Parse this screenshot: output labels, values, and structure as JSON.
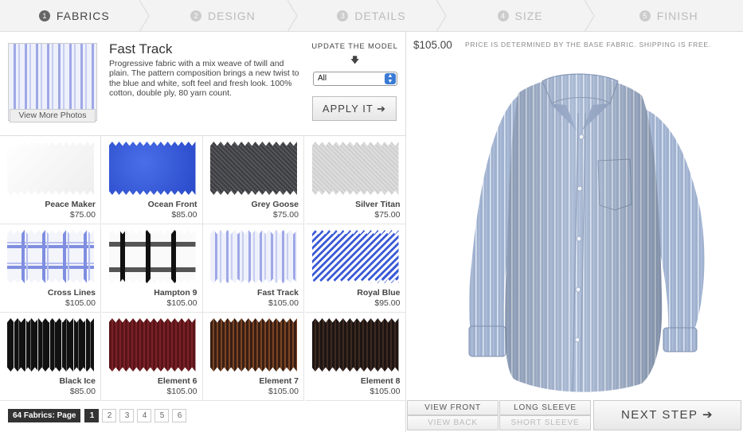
{
  "steps": [
    {
      "num": "1",
      "label": "FABRICS",
      "active": true
    },
    {
      "num": "2",
      "label": "DESIGN",
      "active": false
    },
    {
      "num": "3",
      "label": "DETAILS",
      "active": false
    },
    {
      "num": "4",
      "label": "SIZE",
      "active": false
    },
    {
      "num": "5",
      "label": "FINISH",
      "active": false
    }
  ],
  "selected_fabric": {
    "name": "Fast Track",
    "description": "Progressive fabric with a mix weave of twill and plain. The pattern composition brings a new twist to the blue and white, soft feel and fresh look. 100% cotton, double ply, 80 yarn count.",
    "view_more_label": "View More Photos"
  },
  "update_model": {
    "label": "UPDATE THE MODEL",
    "arrow_icon": "down-arrow",
    "select_value": "All",
    "apply_label": "APPLY IT ➔"
  },
  "fabrics": [
    {
      "name": "Peace Maker",
      "price": "$75.00",
      "pattern": "white"
    },
    {
      "name": "Ocean Front",
      "price": "$85.00",
      "pattern": "blue"
    },
    {
      "name": "Grey Goose",
      "price": "$75.00",
      "pattern": "darkgrey"
    },
    {
      "name": "Silver Titan",
      "price": "$75.00",
      "pattern": "lightgrey"
    },
    {
      "name": "Cross Lines",
      "price": "$105.00",
      "pattern": "check-blue"
    },
    {
      "name": "Hampton 9",
      "price": "$105.00",
      "pattern": "check-black"
    },
    {
      "name": "Fast Track",
      "price": "$105.00",
      "pattern": "stripe-blue"
    },
    {
      "name": "Royal Blue",
      "price": "$95.00",
      "pattern": "diag-blue"
    },
    {
      "name": "Black Ice",
      "price": "$85.00",
      "pattern": "black-stripe"
    },
    {
      "name": "Element 6",
      "price": "$105.00",
      "pattern": "maroon"
    },
    {
      "name": "Element 7",
      "price": "$105.00",
      "pattern": "brown"
    },
    {
      "name": "Element 8",
      "price": "$105.00",
      "pattern": "darkbrown"
    }
  ],
  "pager": {
    "label": "64 Fabrics: Page",
    "pages": [
      "1",
      "2",
      "3",
      "4",
      "5",
      "6"
    ],
    "current": "1"
  },
  "pricing": {
    "price": "$105.00",
    "note": "PRICE IS DETERMINED BY THE BASE FABRIC. SHIPPING IS FREE."
  },
  "view_controls": {
    "view_front": "VIEW FRONT",
    "view_back": "VIEW BACK",
    "long_sleeve": "LONG SLEEVE",
    "short_sleeve": "SHORT SLEEVE",
    "next_step": "NEXT STEP ➔"
  },
  "colors": {
    "shirt_base": "#9fb1cf",
    "accent_dark": "#333333"
  }
}
